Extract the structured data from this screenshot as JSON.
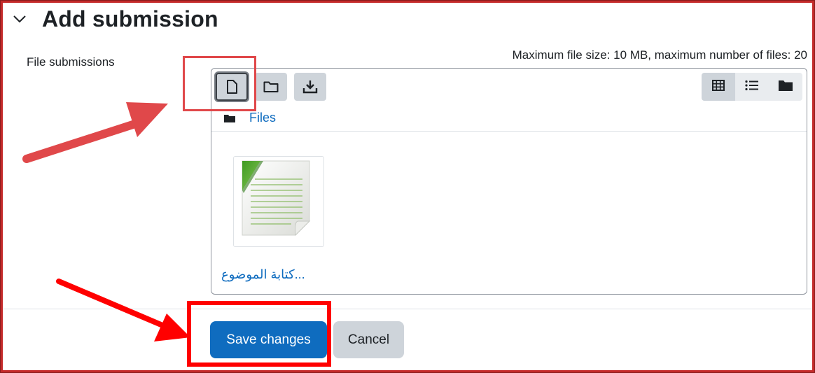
{
  "section": {
    "title": "Add submission",
    "expanded": true
  },
  "field": {
    "label": "File submissions",
    "max_info": "Maximum file size: 10 MB, maximum number of files: 20"
  },
  "filemanager": {
    "toolbar": {
      "add_file_icon": "file-icon",
      "create_folder_icon": "folder-icon",
      "download_icon": "download-icon",
      "views": [
        {
          "name": "icons-view",
          "icon": "grid-icon",
          "active": true
        },
        {
          "name": "list-view",
          "icon": "list-icon",
          "active": false
        },
        {
          "name": "tree-view",
          "icon": "folder-solid-icon",
          "active": false
        }
      ]
    },
    "breadcrumb": {
      "icon": "folder-solid-icon",
      "label": "Files"
    },
    "files": [
      {
        "name": "...كتابة الموضوع",
        "icon": "document-thumbnail-icon"
      }
    ]
  },
  "buttons": {
    "save": "Save changes",
    "cancel": "Cancel"
  },
  "colors": {
    "primary": "#0f6cbf",
    "secondary": "#ced4da",
    "link": "#0f6cbf",
    "annotation_red": "#ff0000",
    "frame_red": "#c42a2a"
  }
}
